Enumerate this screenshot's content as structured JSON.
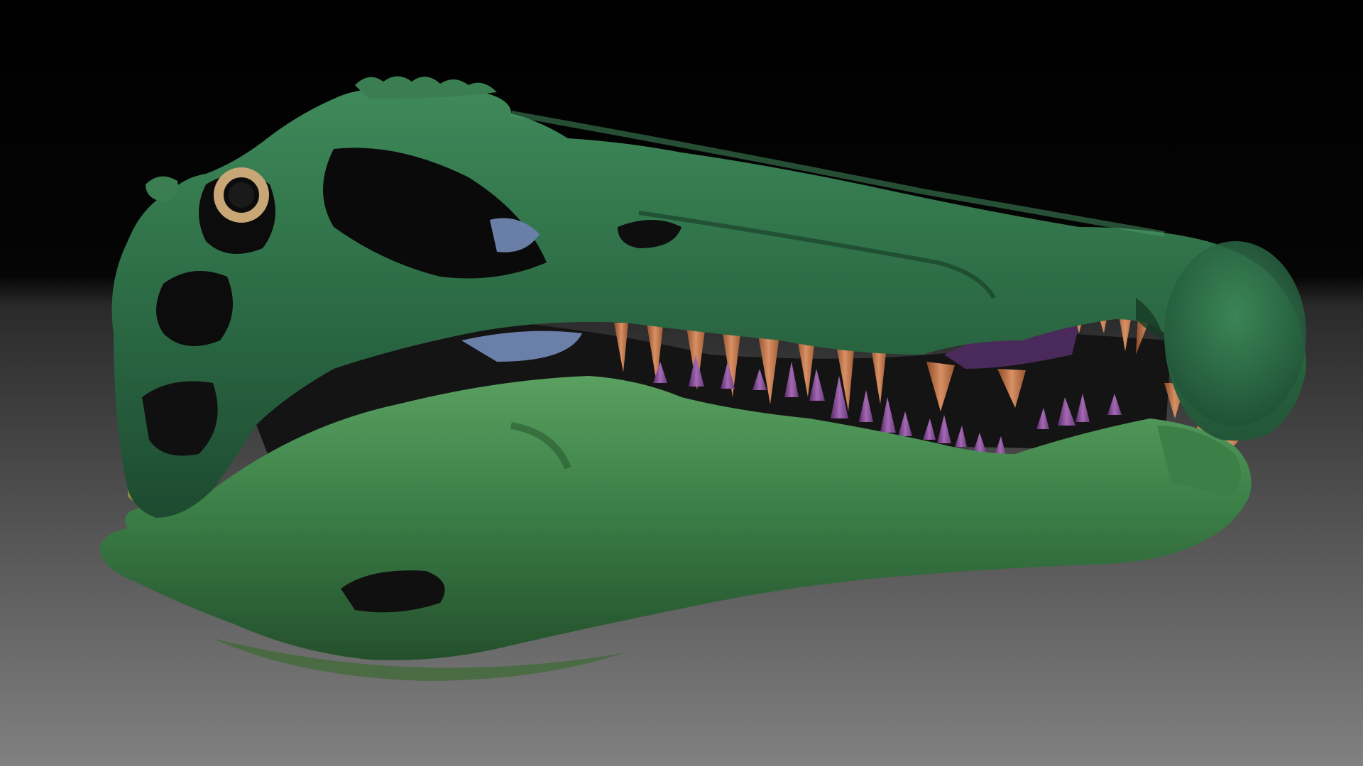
{
  "scene": {
    "background_top_color": "#000000",
    "background_bottom_color": "#808080",
    "skull_color": "#2c6b45",
    "skull_highlight_color": "#3f8a5a",
    "jaw_color": "#3c8048",
    "jaw_highlight_color": "#5aa060",
    "eye_ring_color": "#c8a676",
    "upper_teeth_color": "#c07848",
    "lower_teeth_color": "#8a4e9a",
    "inner_bone_yellow": "#b0aa58",
    "inner_bone_blue": "#6a7fa8",
    "inner_purple": "#4a2a5a"
  }
}
